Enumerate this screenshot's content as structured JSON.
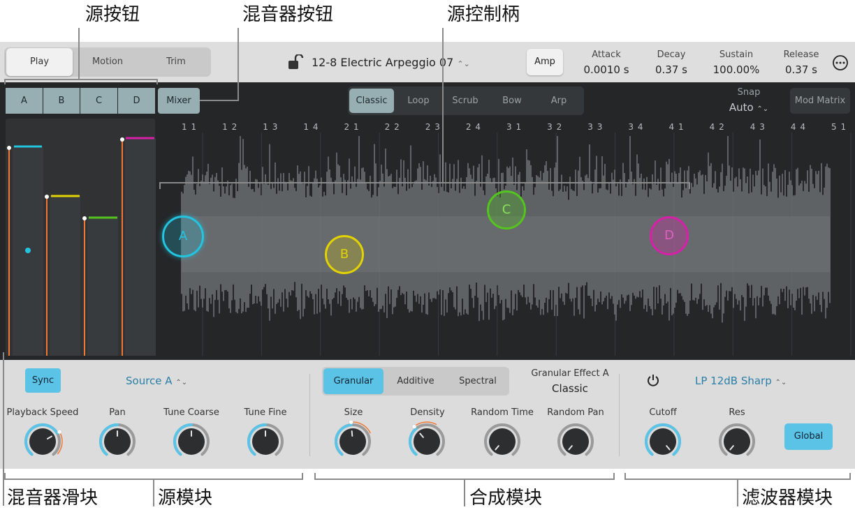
{
  "callouts": {
    "source_buttons": "源按钮",
    "mixer_button": "混音器按钮",
    "source_handles": "源控制柄",
    "mixer_sliders": "混音器滑块",
    "source_module": "源模块",
    "synth_module": "合成模块",
    "filter_module": "滤波器模块"
  },
  "topbar": {
    "view_tabs": [
      "Play",
      "Motion",
      "Trim"
    ],
    "active_view": "Play",
    "patch_name": "12-8 Electric Arpeggio 07",
    "lock_icon": "unlock-icon",
    "amp_button": "Amp",
    "envelope": [
      {
        "label": "Attack",
        "value": "0.0010 s"
      },
      {
        "label": "Decay",
        "value": "0.37 s"
      },
      {
        "label": "Sustain",
        "value": "100.00%"
      },
      {
        "label": "Release",
        "value": "0.37 s"
      }
    ],
    "more_icon": "ellipsis-circle-icon"
  },
  "sources": [
    "A",
    "B",
    "C",
    "D"
  ],
  "mixer_button": "Mixer",
  "play_modes": [
    "Classic",
    "Loop",
    "Scrub",
    "Bow",
    "Arp"
  ],
  "active_play_mode": "Classic",
  "snap": {
    "label": "Snap",
    "value": "Auto"
  },
  "mod_matrix_button": "Mod Matrix",
  "ruler_ticks": [
    "1 1",
    "1 2",
    "1 3",
    "1 4",
    "2 1",
    "2 2",
    "2 3",
    "2 4",
    "3 1",
    "3 2",
    "3 3",
    "3 4",
    "4 1",
    "4 2",
    "4 3",
    "4 4",
    "5 1"
  ],
  "mixer_levels": [
    0.88,
    0.67,
    0.58,
    0.92
  ],
  "colors": {
    "source_a": "#22c4e0",
    "source_b": "#e3d400",
    "source_c": "#54c41e",
    "source_d": "#d620a8",
    "accent_blue": "#5ac3e6",
    "orange": "#f07836"
  },
  "source_module": {
    "sync_button": "Sync",
    "source_select": "Source A",
    "knobs": [
      "Playback Speed",
      "Pan",
      "Tune Coarse",
      "Tune Fine"
    ]
  },
  "synth_module": {
    "tabs": [
      "Granular",
      "Additive",
      "Spectral"
    ],
    "active_tab": "Granular",
    "effect_label": "Granular Effect A",
    "effect_value": "Classic",
    "knobs": [
      "Size",
      "Density",
      "Random Time",
      "Random Pan"
    ]
  },
  "filter_module": {
    "power_icon": "power-icon",
    "filter_type": "LP 12dB Sharp",
    "knobs": [
      "Cutoff",
      "Res"
    ],
    "global_button": "Global"
  }
}
